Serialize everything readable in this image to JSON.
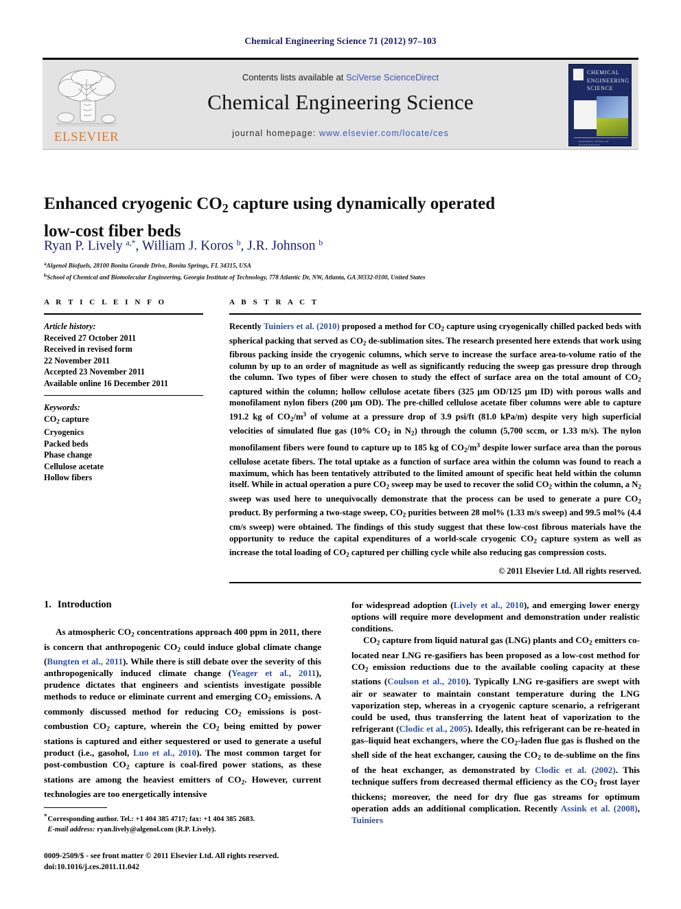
{
  "running_head": "Chemical Engineering Science 71 (2012) 97–103",
  "masthead": {
    "contents_prefix": "Contents lists available at ",
    "contents_link": "SciVerse ScienceDirect",
    "journal_title": "Chemical Engineering Science",
    "homepage_prefix": "journal homepage: ",
    "homepage_url": "www.elsevier.com/locate/ces",
    "publisher_wordmark": "ELSEVIER",
    "cover_title_lines": [
      "CHEMICAL",
      "ENGINEERING",
      "SCIENCE"
    ],
    "cover_footer": "available online at sciencedirect"
  },
  "article": {
    "title_line1_a": "Enhanced cryogenic CO",
    "title_line1_sub": "2",
    "title_line1_b": " capture using dynamically operated",
    "title_line2": "low-cost fiber beds",
    "authors": [
      {
        "name": "Ryan P. Lively ",
        "sup": "a,*",
        "sep": ", "
      },
      {
        "name": "William J. Koros ",
        "sup": "b",
        "sep": ", "
      },
      {
        "name": "J.R. Johnson ",
        "sup": "b",
        "sep": ""
      }
    ],
    "affiliations": [
      {
        "marker": "a",
        "text": "Algenol Biofuels, 28100 Bonita Grande Drive, Bonita Springs, FL 34315, USA"
      },
      {
        "marker": "b",
        "text": "School of Chemical and Biomolecular Engineering, Georgia Institute of Technology, 778 Atlantic Dr, NW, Atlanta, GA 30332-0100, United States"
      }
    ]
  },
  "article_info": {
    "heading": "A R T I C L E   I N F O",
    "history_label": "Article history:",
    "history": [
      "Received 27 October 2011",
      "Received in revised form",
      "22 November 2011",
      "Accepted 23 November 2011",
      "Available online 16 December 2011"
    ],
    "keywords_label": "Keywords:",
    "keywords": [
      "CO2 capture",
      "Cryogenics",
      "Packed beds",
      "Phase change",
      "Cellulose acetate",
      "Hollow fibers"
    ]
  },
  "abstract": {
    "heading": "A B S T R A C T",
    "text": "Recently Tuiniers et al. (2010) proposed a method for CO2 capture using cryogenically chilled packed beds with spherical packing that served as CO2 de-sublimation sites. The research presented here extends that work using fibrous packing inside the cryogenic columns, which serve to increase the surface area-to-volume ratio of the column by up to an order of magnitude as well as significantly reducing the sweep gas pressure drop through the column. Two types of fiber were chosen to study the effect of surface area on the total amount of CO2 captured within the column; hollow cellulose acetate fibers (325 μm OD/125 μm ID) with porous walls and monofilament nylon fibers (200 μm OD). The pre-chilled cellulose acetate fiber columns were able to capture 191.2 kg of CO2/m3 of volume at a pressure drop of 3.9 psi/ft (81.0 kPa/m) despite very high superficial velocities of simulated flue gas (10% CO2 in N2) through the column (5,700 sccm, or 1.33 m/s). The nylon monofilament fibers were found to capture up to 185 kg of CO2/m3 despite lower surface area than the porous cellulose acetate fibers. The total uptake as a function of surface area within the column was found to reach a maximum, which has been tentatively attributed to the limited amount of specific heat held within the column itself. While in actual operation a pure CO2 sweep may be used to recover the solid CO2 within the column, a N2 sweep was used here to unequivocally demonstrate that the process can be used to generate a pure CO2 product. By performing a two-stage sweep, CO2 purities between 28 mol% (1.33 m/s sweep) and 99.5 mol% (4.4 cm/s sweep) were obtained. The findings of this study suggest that these low-cost fibrous materials have the opportunity to reduce the capital expenditures of a world-scale cryogenic CO2 capture system as well as increase the total loading of CO2 captured per chilling cycle while also reducing gas compression costs.",
    "citation_in_text": "Tuiniers et al. (2010)",
    "copyright": "© 2011 Elsevier Ltd. All rights reserved."
  },
  "body": {
    "section_number": "1.",
    "section_title": "Introduction",
    "paragraph_1": "As atmospheric CO2 concentrations approach 400 ppm in 2011, there is concern that anthropogenic CO2 could induce global climate change (Bungten et al., 2011). While there is still debate over the severity of this anthropogenically induced climate change (Yeager et al., 2011), prudence dictates that engineers and scientists investigate possible methods to reduce or eliminate current and emerging CO2 emissions. A commonly discussed method for reducing CO2 emissions is post-combustion CO2 capture, wherein the CO2 being emitted by power stations is captured and either sequestered or used to generate a useful product (i.e., gasohol, Luo et al., 2010). The most common target for post-combustion CO2 capture is coal-fired power stations, as these stations are among the heaviest emitters of CO2. However, current technologies are too energetically intensive for widespread adoption (Lively et al., 2010), and emerging lower energy options will require more development and demonstration under realistic conditions.",
    "paragraph_2": "CO2 capture from liquid natural gas (LNG) plants and CO2 emitters co-located near LNG re-gasifiers has been proposed as a low-cost method for CO2 emission reductions due to the available cooling capacity at these stations (Coulson et al., 2010). Typically LNG re-gasifiers are swept with air or seawater to maintain constant temperature during the LNG vaporization step, whereas in a cryogenic capture scenario, a refrigerant could be used, thus transferring the latent heat of vaporization to the refrigerant (Clodic et al., 2005). Ideally, this refrigerant can be re-heated in gas–liquid heat exchangers, where the CO2-laden flue gas is flushed on the shell side of the heat exchanger, causing the CO2 to de-sublime on the fins of the heat exchanger, as demonstrated by Clodic et al. (2002). This technique suffers from decreased thermal efficiency as the CO2 frost layer thickens; moreover, the need for dry flue gas streams for optimum operation adds an additional complication. Recently Assink et al. (2008), Tuiniers"
  },
  "footnote": {
    "corresponding_label": "Corresponding author.",
    "tel": "Tel.: +1 404 385 4717; fax: +1 404 385 2683.",
    "email_label": "E-mail address:",
    "email": "ryan.lively@algenol.com (R.P. Lively)."
  },
  "footer": {
    "issn_line": "0009-2509/$ - see front matter © 2011 Elsevier Ltd. All rights reserved.",
    "doi_line": "doi:10.1016/j.ces.2011.11.042"
  },
  "colors": {
    "link_blue": "#3a53b8",
    "cite_blue": "#2f4fa0",
    "header_navy": "#1a1a6e",
    "elsevier_orange": "#e87722",
    "masthead_gray": "#e3e3e3",
    "cover_navy": "#1b2a63"
  }
}
